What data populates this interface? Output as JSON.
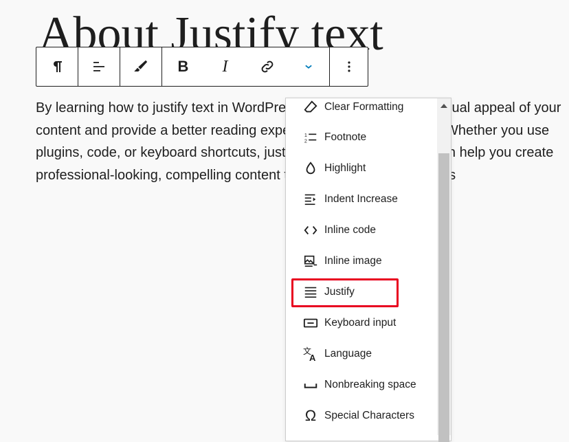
{
  "heading": "About Justify text",
  "paragraph": "By learning how to justify text in WordPress, you can improve the visual appeal of your content and provide a better reading experience for your audience. Whether you use plugins, code, or keyboard shortcuts, justifying text in WordPress can help you create professional-looking, compelling content that drives traffic and boosts",
  "toolbar": {
    "buttons": [
      {
        "name": "paragraph-icon"
      },
      {
        "name": "align-left-icon"
      },
      {
        "name": "highlighter-icon"
      },
      {
        "name": "bold-icon",
        "label": "B"
      },
      {
        "name": "italic-icon",
        "label": "I"
      },
      {
        "name": "link-icon"
      },
      {
        "name": "chevron-down-icon"
      },
      {
        "name": "more-options-icon"
      }
    ],
    "accent_color": "#007cba"
  },
  "menu": {
    "items": [
      {
        "label": "Clear Formatting",
        "icon": "clear-formatting-icon"
      },
      {
        "label": "Footnote",
        "icon": "footnote-icon"
      },
      {
        "label": "Highlight",
        "icon": "droplet-icon"
      },
      {
        "label": "Indent Increase",
        "icon": "indent-increase-icon"
      },
      {
        "label": "Inline code",
        "icon": "code-icon"
      },
      {
        "label": "Inline image",
        "icon": "image-icon"
      },
      {
        "label": "Justify",
        "icon": "justify-icon"
      },
      {
        "label": "Keyboard input",
        "icon": "keyboard-icon"
      },
      {
        "label": "Language",
        "icon": "translate-icon"
      },
      {
        "label": "Nonbreaking space",
        "icon": "nonbreaking-space-icon"
      },
      {
        "label": "Special Characters",
        "icon": "omega-icon"
      }
    ],
    "highlighted_item": "Justify",
    "highlight_color": "#e8001f"
  }
}
